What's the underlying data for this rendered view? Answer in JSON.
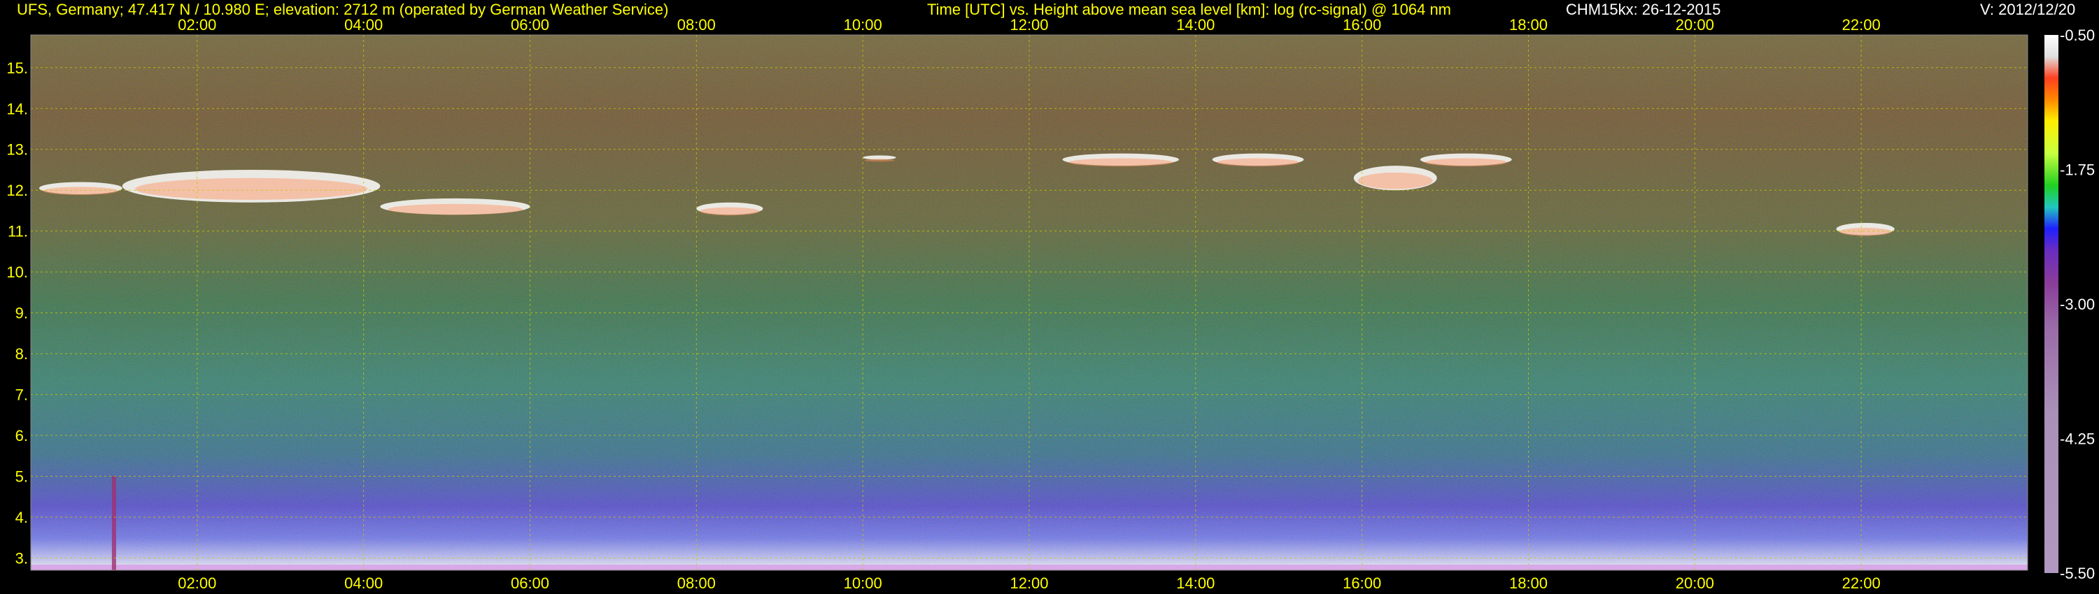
{
  "header": {
    "station": "UFS, Germany; 47.417 N / 10.980 E; elevation: 2712 m  (operated by German Weather Service)",
    "axis_title": "Time [UTC] vs. Height above mean sea level [km]: log (rc-signal) @ 1064 nm",
    "instrument": "CHM15kx: 26-12-2015",
    "version": "V: 2012/12/20"
  },
  "colors": {
    "background": "#000000",
    "label": "#ffff00",
    "grid": "#c8c800",
    "header_right": "#ffffff"
  },
  "chart_data": {
    "type": "heatmap",
    "title": "Time [UTC] vs. Height above mean sea level [km]: log (rc-signal) @ 1064 nm",
    "x_unit": "hours UTC",
    "xlim": [
      0.0,
      24.0
    ],
    "x_ticks": [
      {
        "value": 2,
        "label": "02:00"
      },
      {
        "value": 4,
        "label": "04:00"
      },
      {
        "value": 6,
        "label": "06:00"
      },
      {
        "value": 8,
        "label": "08:00"
      },
      {
        "value": 10,
        "label": "10:00"
      },
      {
        "value": 12,
        "label": "12:00"
      },
      {
        "value": 14,
        "label": "14:00"
      },
      {
        "value": 16,
        "label": "16:00"
      },
      {
        "value": 18,
        "label": "18:00"
      },
      {
        "value": 20,
        "label": "20:00"
      },
      {
        "value": 22,
        "label": "22:00"
      }
    ],
    "y_unit": "km",
    "ylim": [
      2.7,
      15.8
    ],
    "y_ticks": [
      {
        "value": 3,
        "label": "3."
      },
      {
        "value": 4,
        "label": "4."
      },
      {
        "value": 5,
        "label": "5."
      },
      {
        "value": 6,
        "label": "6."
      },
      {
        "value": 7,
        "label": "7."
      },
      {
        "value": 8,
        "label": "8."
      },
      {
        "value": 9,
        "label": "9."
      },
      {
        "value": 10,
        "label": "10."
      },
      {
        "value": 11,
        "label": "11."
      },
      {
        "value": 12,
        "label": "12."
      },
      {
        "value": 13,
        "label": "13."
      },
      {
        "value": 14,
        "label": "14."
      },
      {
        "value": 15,
        "label": "15."
      }
    ],
    "grid": true,
    "colorbar": {
      "range": [
        -5.5,
        -0.5
      ],
      "ticks": [
        {
          "value": -0.5,
          "label": "-0.50"
        },
        {
          "value": -1.75,
          "label": "-1.75"
        },
        {
          "value": -3.0,
          "label": "-3.00"
        },
        {
          "value": -4.25,
          "label": "-4.25"
        },
        {
          "value": -5.5,
          "label": "-5.50"
        }
      ],
      "stops": [
        {
          "value": -0.5,
          "color": "#ffffff"
        },
        {
          "value": -0.7,
          "color": "#e0e0e0"
        },
        {
          "value": -0.9,
          "color": "#ff4020"
        },
        {
          "value": -1.1,
          "color": "#ff8800"
        },
        {
          "value": -1.3,
          "color": "#ffee00"
        },
        {
          "value": -1.6,
          "color": "#c8ff40"
        },
        {
          "value": -1.9,
          "color": "#20d020"
        },
        {
          "value": -2.1,
          "color": "#20c8c0"
        },
        {
          "value": -2.3,
          "color": "#2020ff"
        },
        {
          "value": -2.5,
          "color": "#6a2cc0"
        },
        {
          "value": -2.8,
          "color": "#8a3c9a"
        },
        {
          "value": -3.2,
          "color": "#9a6aa8"
        },
        {
          "value": -4.0,
          "color": "#a890b8"
        },
        {
          "value": -5.5,
          "color": "#b098c0"
        }
      ]
    },
    "cloud_layers": [
      {
        "t0": 0.1,
        "t1": 1.1,
        "base": 11.9,
        "top": 12.2
      },
      {
        "t0": 1.1,
        "t1": 4.2,
        "base": 11.7,
        "top": 12.5
      },
      {
        "t0": 4.2,
        "t1": 6.0,
        "base": 11.4,
        "top": 11.8
      },
      {
        "t0": 8.0,
        "t1": 8.8,
        "base": 11.4,
        "top": 11.7
      },
      {
        "t0": 10.0,
        "t1": 10.4,
        "base": 12.75,
        "top": 12.85
      },
      {
        "t0": 12.4,
        "t1": 13.8,
        "base": 12.6,
        "top": 12.9
      },
      {
        "t0": 14.2,
        "t1": 15.3,
        "base": 12.6,
        "top": 12.9
      },
      {
        "t0": 15.9,
        "t1": 16.9,
        "base": 12.0,
        "top": 12.6
      },
      {
        "t0": 16.7,
        "t1": 17.8,
        "base": 12.6,
        "top": 12.9
      },
      {
        "t0": 21.7,
        "t1": 22.4,
        "base": 10.9,
        "top": 11.2
      }
    ]
  }
}
